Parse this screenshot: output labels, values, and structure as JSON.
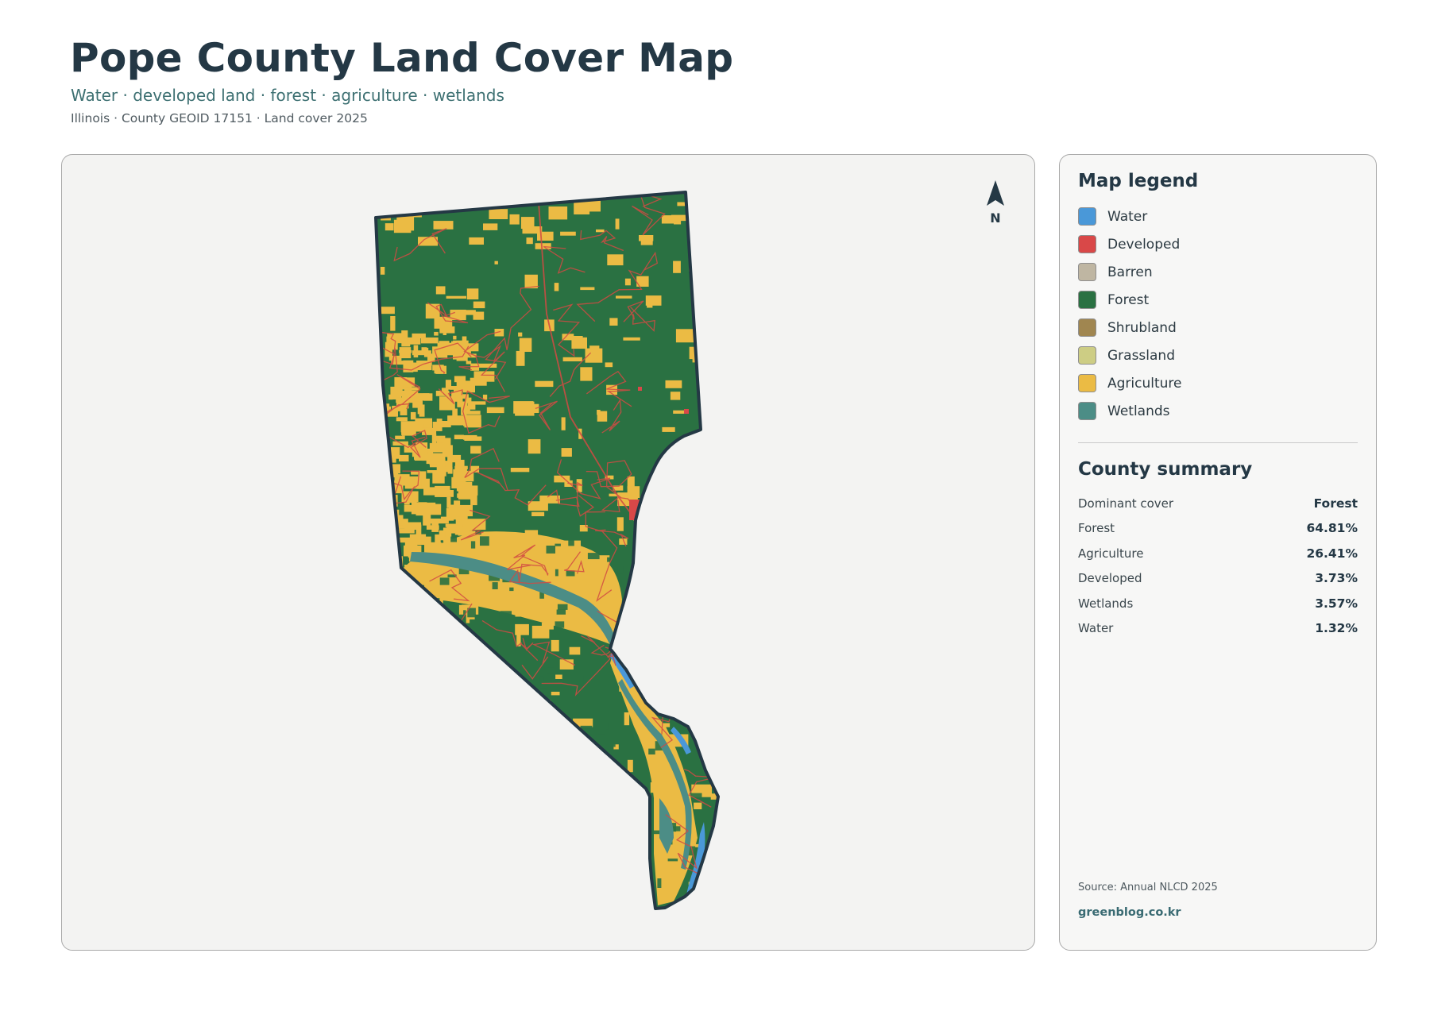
{
  "header": {
    "title": "Pope County Land Cover Map",
    "subtitle": "Water · developed land · forest · agriculture · wetlands",
    "meta": "Illinois · County GEOID 17151 · Land cover 2025"
  },
  "map": {
    "north_label": "N",
    "background_color": "#f3f3f2",
    "county_outline_color": "#243845",
    "road_color": "#d24b43"
  },
  "legend": {
    "title": "Map legend",
    "items": [
      {
        "label": "Water",
        "color": "#4a98d8"
      },
      {
        "label": "Developed",
        "color": "#d94848"
      },
      {
        "label": "Barren",
        "color": "#bfb6a2"
      },
      {
        "label": "Forest",
        "color": "#2a7142"
      },
      {
        "label": "Shrubland",
        "color": "#a08650"
      },
      {
        "label": "Grassland",
        "color": "#cdcd84"
      },
      {
        "label": "Agriculture",
        "color": "#ebbb44"
      },
      {
        "label": "Wetlands",
        "color": "#4c8d86"
      }
    ]
  },
  "summary": {
    "title": "County summary",
    "rows": [
      {
        "label": "Dominant cover",
        "value": "Forest"
      },
      {
        "label": "Forest",
        "value": "64.81%"
      },
      {
        "label": "Agriculture",
        "value": "26.41%"
      },
      {
        "label": "Developed",
        "value": "3.73%"
      },
      {
        "label": "Wetlands",
        "value": "3.57%"
      },
      {
        "label": "Water",
        "value": "1.32%"
      }
    ]
  },
  "footer": {
    "source": "Source: Annual NLCD 2025",
    "site": "greenblog.co.kr"
  }
}
